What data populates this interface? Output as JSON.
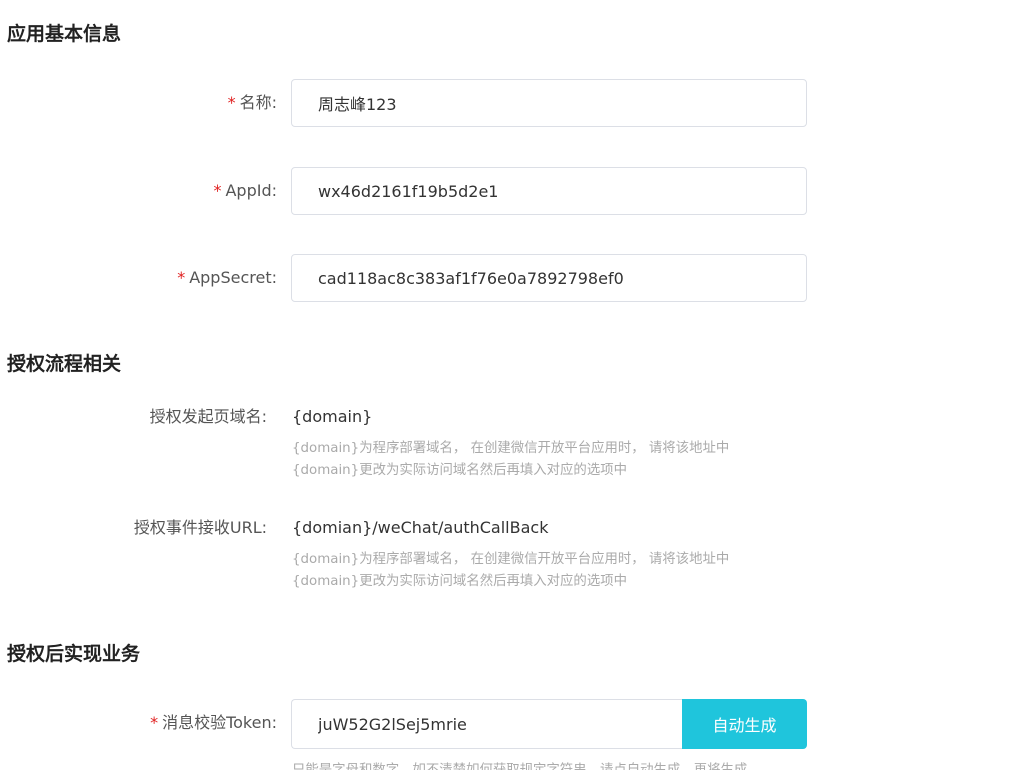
{
  "sections": {
    "basic": "应用基本信息",
    "auth_flow": "授权流程相关",
    "business": "授权后实现业务"
  },
  "fields": {
    "name": {
      "label": "名称:",
      "value": "周志峰123"
    },
    "appid": {
      "label": "AppId:",
      "value": "wx46d2161f19b5d2e1"
    },
    "appsecret": {
      "label": "AppSecret:",
      "value": "cad118ac8c383af1f76e0a7892798ef0"
    }
  },
  "required_mark": "*",
  "auth": {
    "domain": {
      "label": "授权发起页域名:",
      "value": "{domain}",
      "help_line1": "{domain}为程序部署域名， 在创建微信开放平台应用时， 请将该地址中",
      "help_line2": "{domain}更改为实际访问域名然后再填入对应的选项中"
    },
    "callback": {
      "label": "授权事件接收URL:",
      "value": "{domian}/weChat/authCallBack",
      "help_line1": "{domain}为程序部署域名， 在创建微信开放平台应用时， 请将该地址中",
      "help_line2": "{domain}更改为实际访问域名然后再填入对应的选项中"
    }
  },
  "token": {
    "label": "消息校验Token:",
    "value": "juW52G2lSej5mrie",
    "button": "自动生成",
    "help": "只能是字母和数字，如不清楚如何获取规定字符串，请点自动生成，再将生成"
  }
}
